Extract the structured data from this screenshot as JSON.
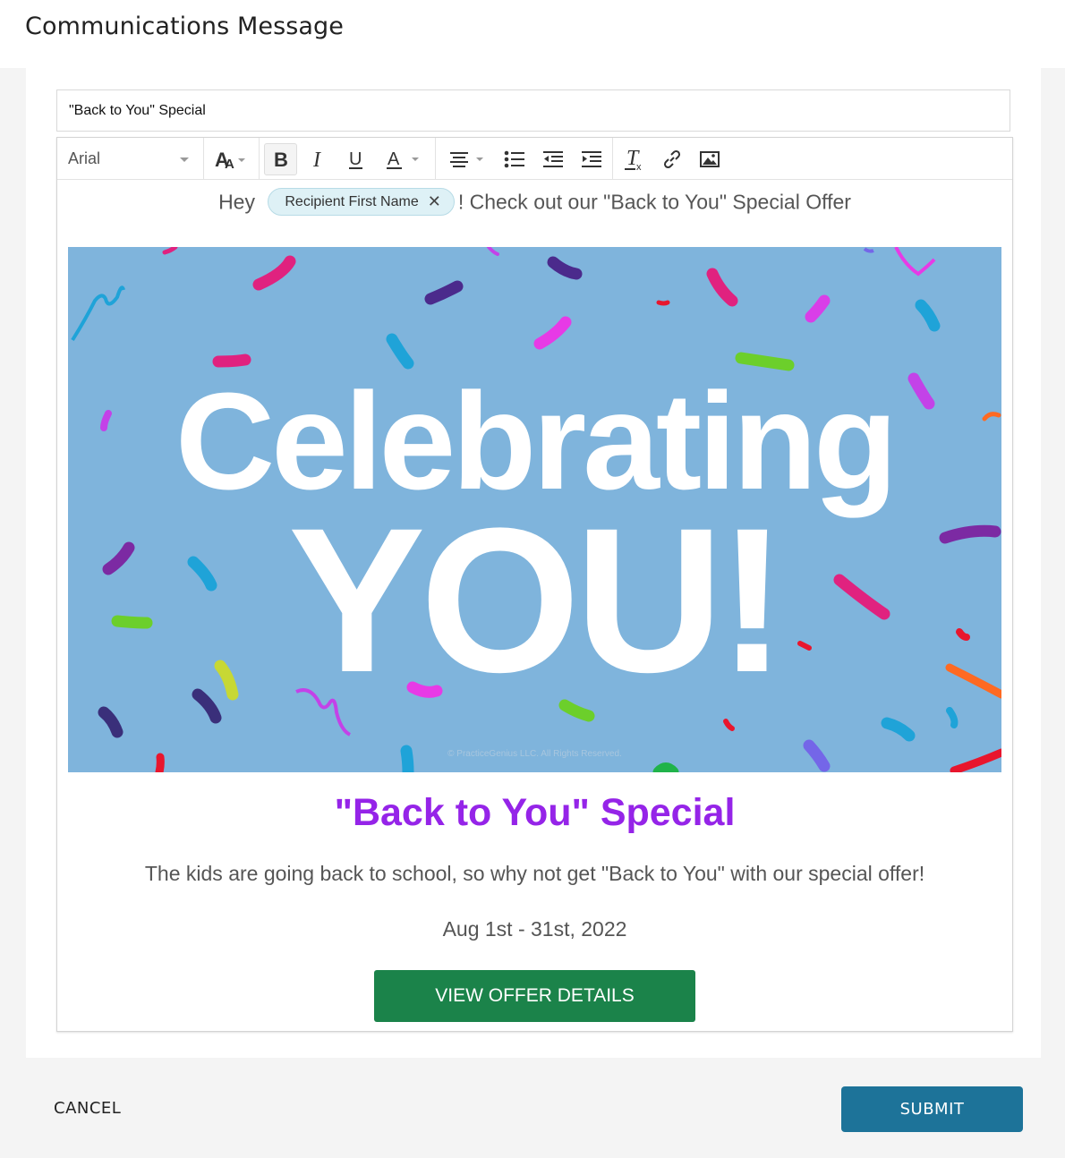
{
  "header": {
    "title": "Communications Message"
  },
  "subject": {
    "value": "\"Back to You\" Special"
  },
  "toolbar": {
    "font": "Arial",
    "icons": [
      "font-size-icon",
      "bold-icon",
      "italic-icon",
      "underline-icon",
      "text-color-icon",
      "align-center-icon",
      "bulleted-list-icon",
      "outdent-icon",
      "indent-icon",
      "clear-formatting-icon",
      "link-icon",
      "image-icon"
    ]
  },
  "body": {
    "greeting_prefix": "Hey",
    "merge_tag": "Recipient First Name",
    "greeting_suffix": "! Check out our \"Back to You\" Special Offer",
    "banner": {
      "line1": "Celebrating",
      "line2": "YOU!",
      "copyright": "© PracticeGenius LLC. All Rights Reserved."
    },
    "heading": "\"Back to You\" Special",
    "description": "The kids are going back to school, so why not get \"Back to You\" with our special offer!",
    "dates": "Aug 1st - 31st, 2022",
    "cta_label": "VIEW OFFER DETAILS"
  },
  "footer": {
    "cancel_label": "CANCEL",
    "submit_label": "SUBMIT"
  },
  "colors": {
    "heading": "#9524e8",
    "cta": "#1b834a",
    "submit": "#1d7399",
    "banner_bg": "#7fb4dc",
    "chip_bg": "#def1f6"
  }
}
